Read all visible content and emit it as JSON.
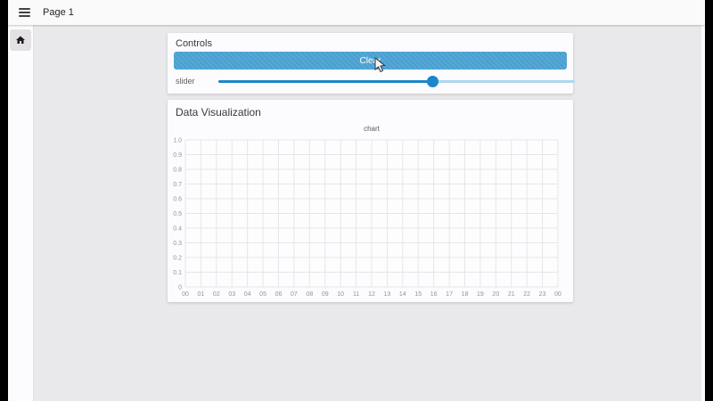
{
  "topbar": {
    "title": "Page 1"
  },
  "controls_card": {
    "title": "Controls",
    "clear_button_label": "Clear",
    "slider_label": "slider",
    "slider_value_percent": 60
  },
  "viz_card": {
    "title": "Data Visualization"
  },
  "chart_data": {
    "type": "line",
    "title": "chart",
    "series": [],
    "x_tick_labels": [
      "00",
      "01",
      "02",
      "03",
      "04",
      "05",
      "06",
      "07",
      "08",
      "09",
      "10",
      "11",
      "12",
      "13",
      "14",
      "15",
      "16",
      "17",
      "18",
      "19",
      "20",
      "21",
      "22",
      "23",
      "00"
    ],
    "y_tick_labels": [
      "1.0",
      "0.9",
      "0.8",
      "0.7",
      "0.6",
      "0.5",
      "0.4",
      "0.3",
      "0.2",
      "0.1",
      "0"
    ],
    "ylim": [
      0,
      1
    ],
    "grid": true,
    "legend": false,
    "note": "empty chart - no data plotted"
  },
  "colors": {
    "button_blue": "#4aa2d3",
    "slider_fill_blue": "#1a87c8",
    "slider_rest_blue": "#aed7ee",
    "grid_line": "#e7e5eb",
    "tick_text": "#96949c",
    "chart_title_text": "#5c5a60"
  }
}
